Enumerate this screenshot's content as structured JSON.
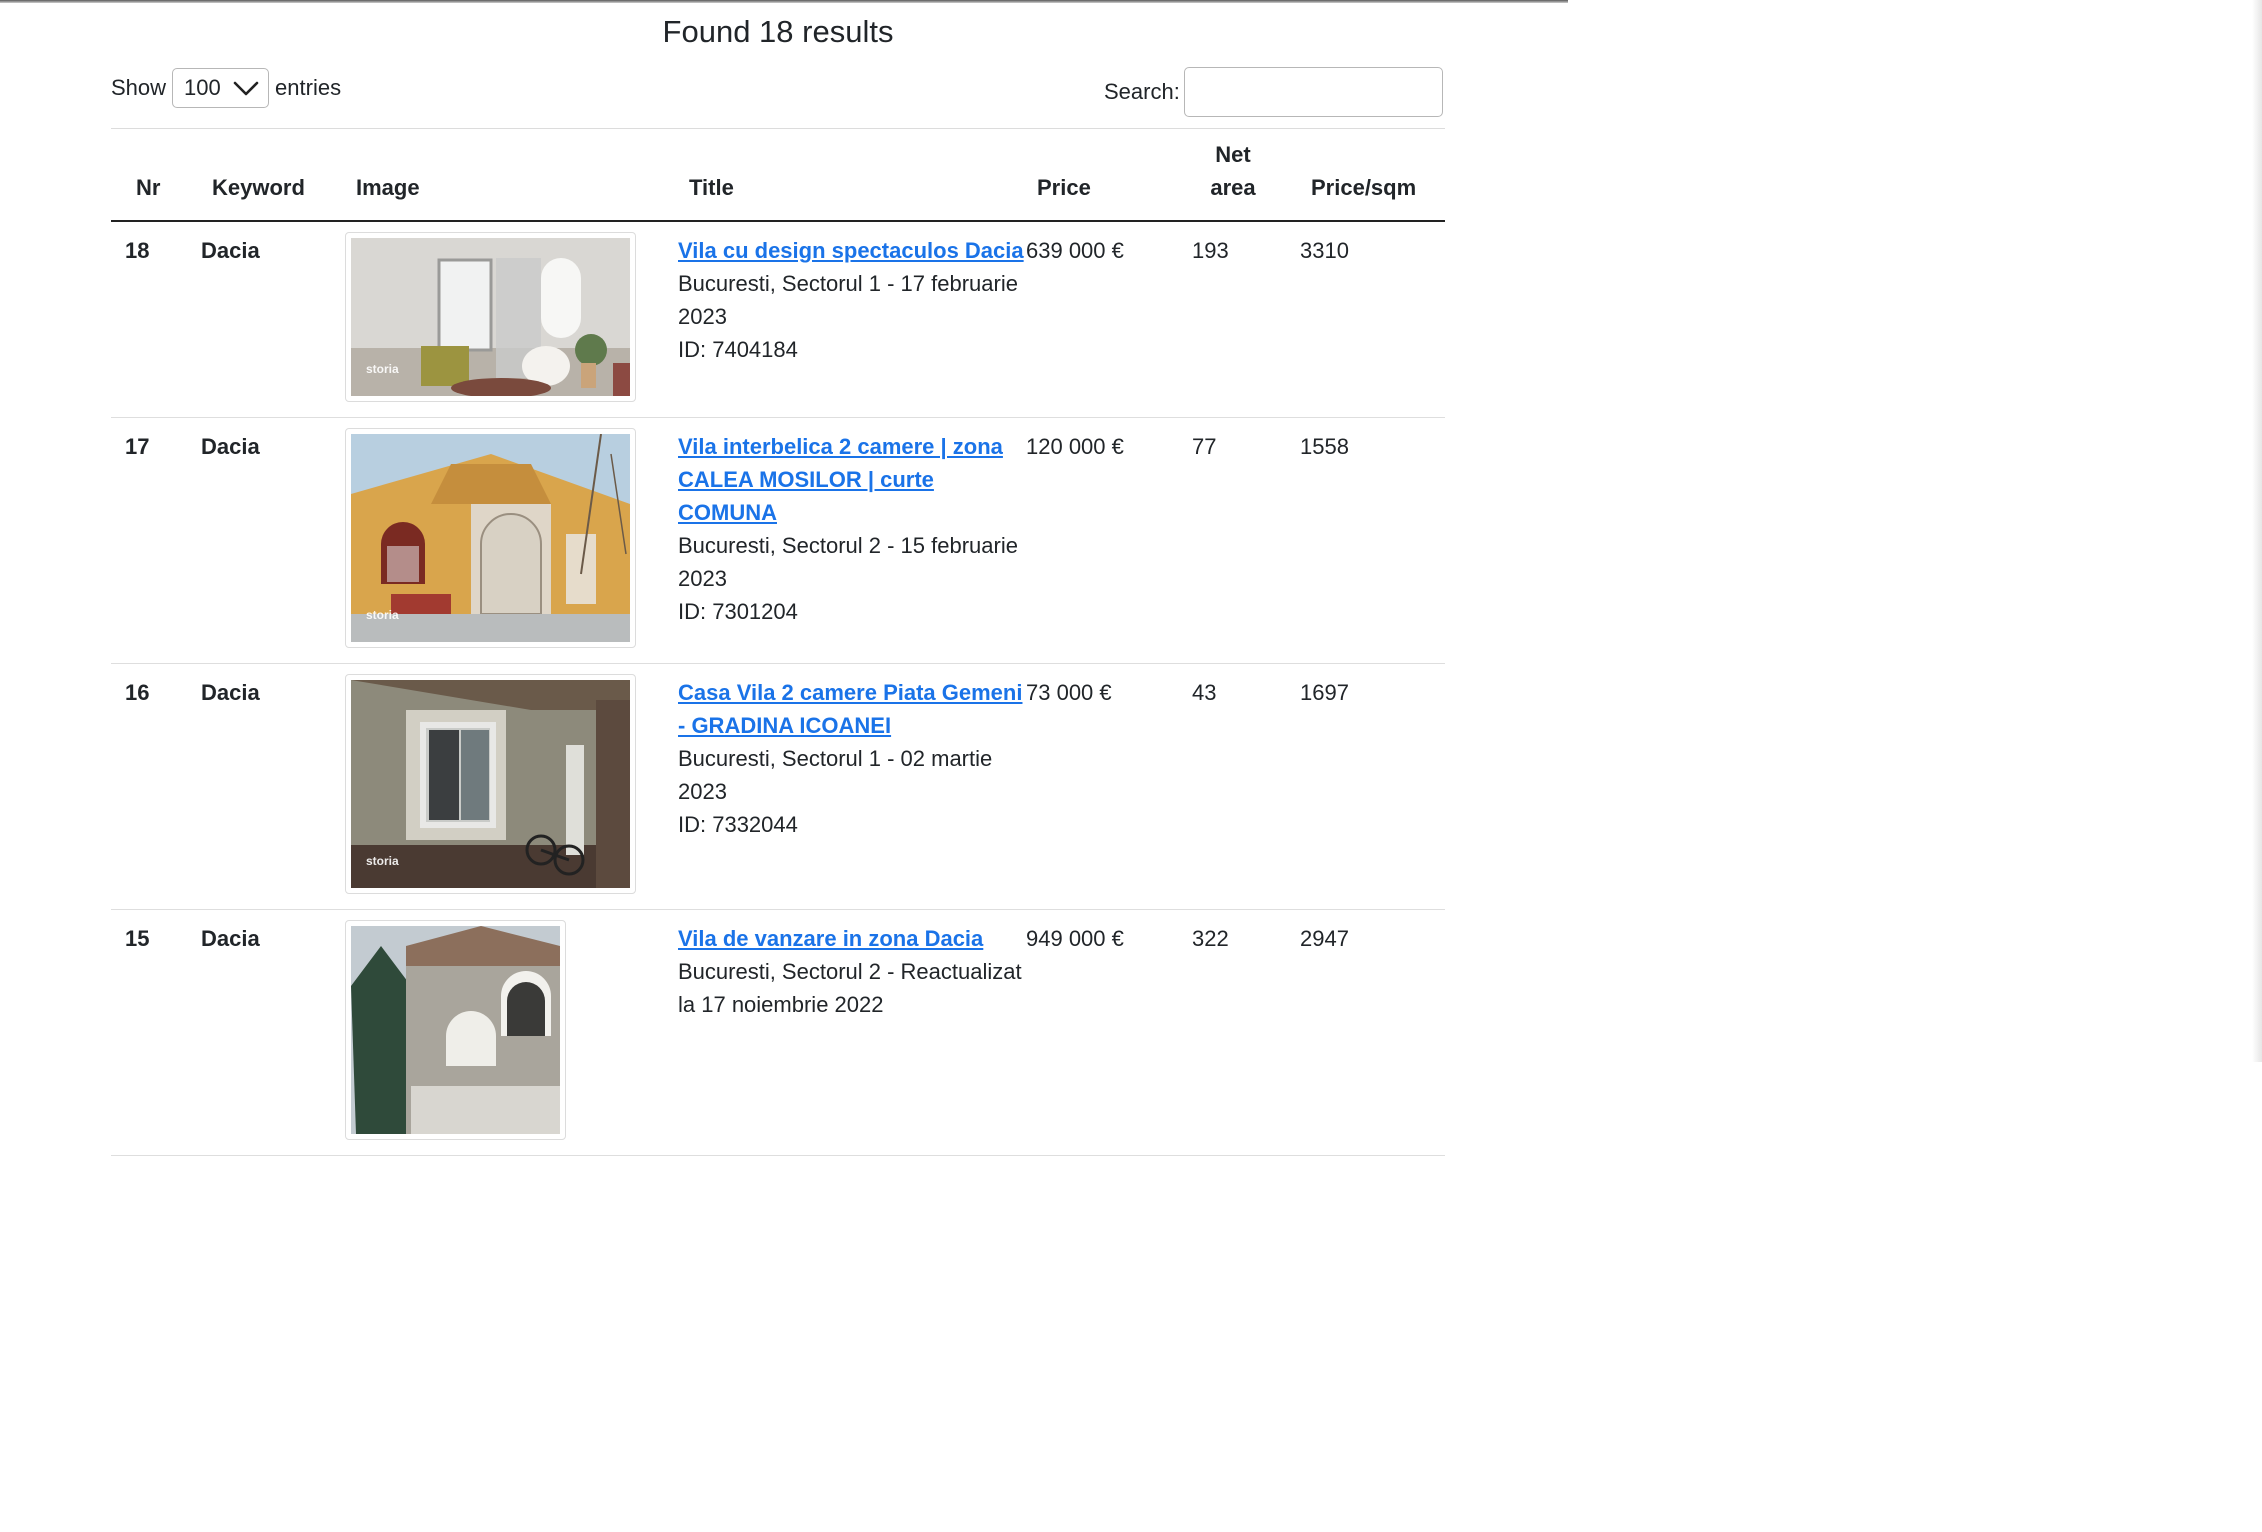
{
  "header": {
    "title": "Found 18 results"
  },
  "controls": {
    "show_label": "Show",
    "entries_value": "100",
    "entries_label": "entries",
    "search_label": "Search:",
    "search_value": ""
  },
  "table": {
    "columns": [
      "Nr",
      "Keyword",
      "Image",
      "Title",
      "Price",
      "Net area",
      "Price/sqm"
    ],
    "rows": [
      {
        "nr": "18",
        "keyword": "Dacia",
        "title": "Vila cu design spectaculos Dacia",
        "location": "Bucuresti, Sectorul 1 - 17 februarie 2023",
        "id": "ID: 7404184",
        "price": "639 000 €",
        "area": "193",
        "price_sqm": "3310",
        "watermark": "storia",
        "image_desc": "interior-room-photo"
      },
      {
        "nr": "17",
        "keyword": "Dacia",
        "title": "Vila interbelica 2 camere | zona CALEA MOSILOR | curte COMUNA",
        "location": "Bucuresti, Sectorul 2 - 15 februarie 2023",
        "id": "ID: 7301204",
        "price": "120 000 €",
        "area": "77",
        "price_sqm": "1558",
        "watermark": "storia",
        "image_desc": "old-villa-facade-photo"
      },
      {
        "nr": "16",
        "keyword": "Dacia",
        "title": "Casa Vila 2 camere Piata Gemeni - GRADINA ICOANEI",
        "location": "Bucuresti, Sectorul 1 - 02 martie 2023",
        "id": "ID: 7332044",
        "price": "73 000 €",
        "area": "43",
        "price_sqm": "1697",
        "watermark": "storia",
        "image_desc": "house-window-bicycle-photo"
      },
      {
        "nr": "15",
        "keyword": "Dacia",
        "title": "Vila de vanzare in zona Dacia",
        "location": "Bucuresti, Sectorul 2 - Reactualizat la 17 noiembrie 2022",
        "id": "",
        "price": "949 000 €",
        "area": "322",
        "price_sqm": "2947",
        "watermark": "",
        "image_desc": "villa-exterior-photo"
      }
    ]
  },
  "colors": {
    "link": "#1a73e8",
    "text": "#212529",
    "rule": "#dedede"
  }
}
